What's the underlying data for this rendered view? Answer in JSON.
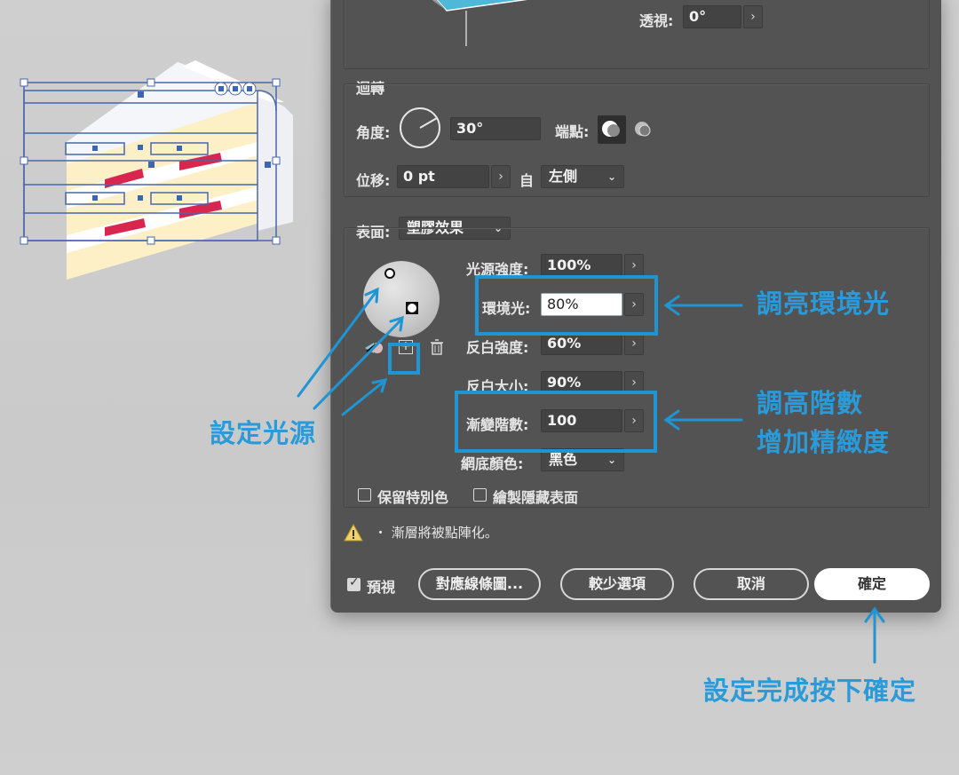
{
  "dialog": {
    "perspective": {
      "label": "透視:",
      "value": "0°"
    },
    "revolve": {
      "title": "迴轉",
      "angle_label": "角度:",
      "angle_value": "30°",
      "cap_label": "端點:",
      "offset_label": "位移:",
      "offset_value": "0 pt",
      "from_label": "自",
      "from_value": "左側"
    },
    "surface": {
      "label": "表面:",
      "value": "塑膠效果",
      "light_intensity": {
        "label": "光源強度:",
        "value": "100%"
      },
      "ambient_light": {
        "label": "環境光:",
        "value": "80%"
      },
      "highlight_intensity": {
        "label": "反白強度:",
        "value": "60%"
      },
      "highlight_size": {
        "label": "反白大小:",
        "value": "90%"
      },
      "blend_steps": {
        "label": "漸變階數:",
        "value": "100"
      },
      "shading_color": {
        "label": "網底顏色:",
        "value": "黑色"
      }
    },
    "options": {
      "preserve_spot": {
        "label": "保留特別色",
        "checked": false
      },
      "draw_hidden": {
        "label": "繪製隱藏表面",
        "checked": false
      }
    },
    "warning": "・ 漸層將被點陣化。",
    "footer": {
      "preview_label": "預視",
      "preview_checked": true,
      "map_art_label": "對應線條圖...",
      "fewer_options_label": "較少選項",
      "cancel_label": "取消",
      "ok_label": "確定"
    }
  },
  "annotations": {
    "ambient": "調亮環境光",
    "steps_line1": "調高階數",
    "steps_line2": "增加精緻度",
    "light_source": "設定光源",
    "confirm": "設定完成按下確定",
    "color": "#1f95d3"
  },
  "icons": {
    "stepper": "›",
    "chevron": "⌄",
    "warning": "⚠",
    "trash": "🗑"
  }
}
